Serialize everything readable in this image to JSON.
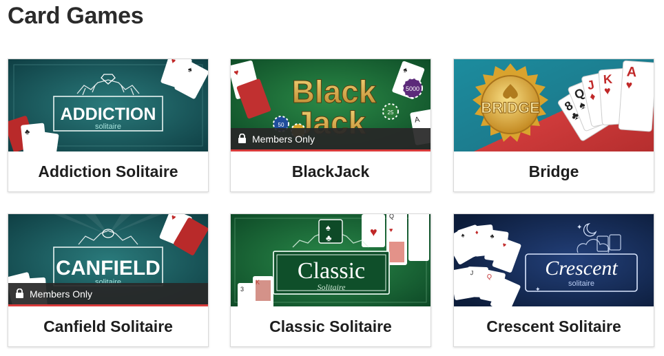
{
  "page": {
    "title": "Card Games"
  },
  "members_label": "Members Only",
  "games": [
    {
      "name": "Addiction Solitaire",
      "members_only": false,
      "logo_main": "ADDICTION",
      "logo_sub": "solitaire"
    },
    {
      "name": "BlackJack",
      "members_only": true,
      "logo_line1": "Black",
      "logo_line2": "Jack",
      "chip_a": "5000",
      "chip_b": "25",
      "chip_c": "50"
    },
    {
      "name": "Bridge",
      "members_only": false,
      "logo_main": "BRIDGE"
    },
    {
      "name": "Canfield Solitaire",
      "members_only": true,
      "logo_main": "CANFIELD",
      "logo_sub": "solitaire"
    },
    {
      "name": "Classic Solitaire",
      "members_only": false,
      "logo_main": "Classic",
      "logo_sub": "Solitaire"
    },
    {
      "name": "Crescent Solitaire",
      "members_only": false,
      "logo_main": "Crescent",
      "logo_sub": "solitaire"
    }
  ],
  "colors": {
    "teal": "#1c5d60",
    "felt_green": "#1e6b3a",
    "navy": "#14284b",
    "red_accent": "#d93a3a",
    "gold": "#e3b13b"
  },
  "icons": [
    "lock-icon",
    "diamond-icon",
    "spade-icon",
    "club-icon",
    "moon-icon",
    "star-icon"
  ]
}
